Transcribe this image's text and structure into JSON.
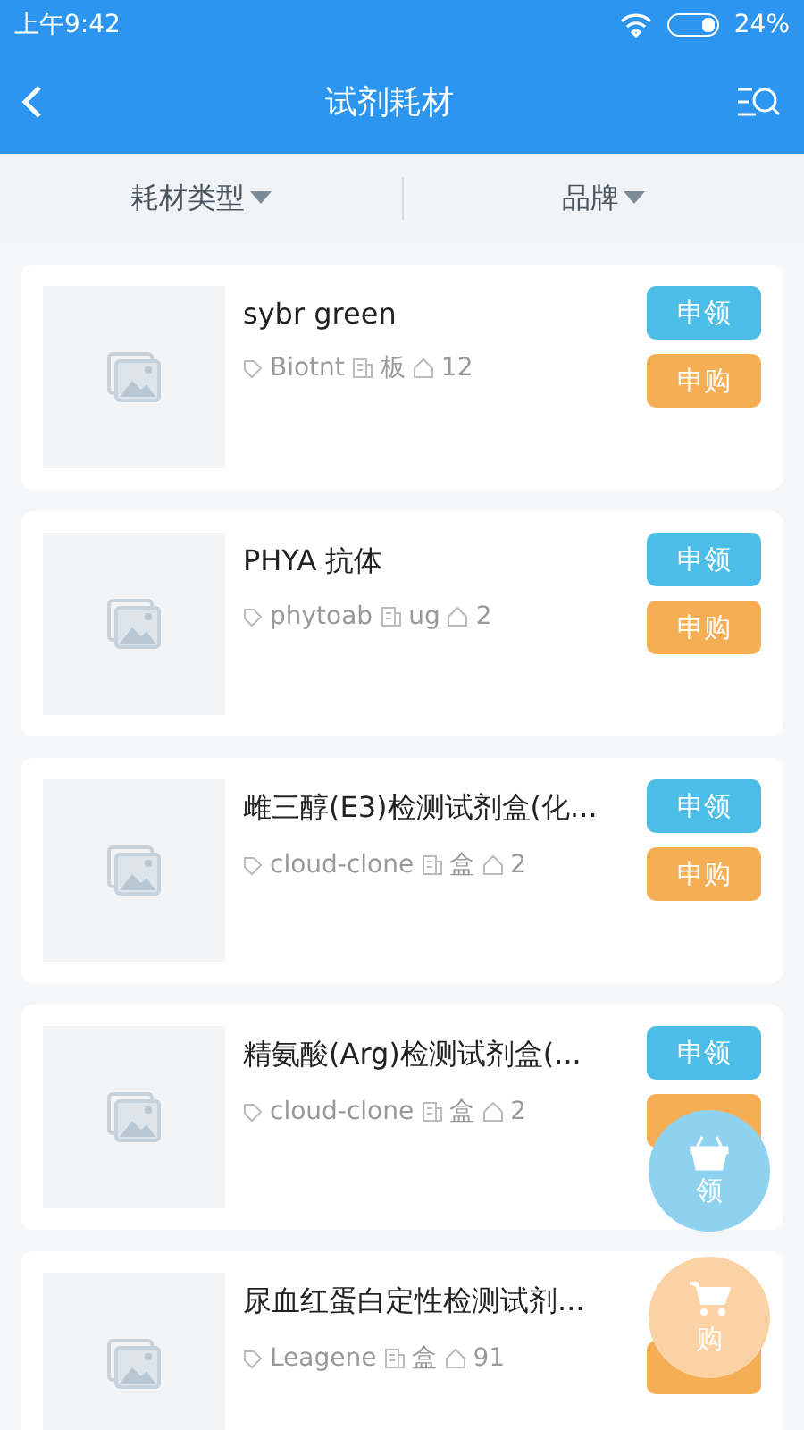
{
  "status_bar": {
    "time": "上午9:42",
    "battery": "24%"
  },
  "header": {
    "title": "试剂耗材"
  },
  "filters": [
    {
      "label": "耗材类型"
    },
    {
      "label": "品牌"
    }
  ],
  "items": [
    {
      "name": "sybr green",
      "brand": "Biotnt",
      "unit": "板",
      "stock": "12",
      "buttons": [
        {
          "kind": "request",
          "label": "申领"
        },
        {
          "kind": "purchase",
          "label": "申购"
        }
      ]
    },
    {
      "name": "PHYA 抗体",
      "brand": "phytoab",
      "unit": "ug",
      "stock": "2",
      "buttons": [
        {
          "kind": "request",
          "label": "申领"
        },
        {
          "kind": "purchase",
          "label": "申购"
        }
      ]
    },
    {
      "name": "雌三醇(E3)检测试剂盒(化...",
      "brand": "cloud-clone",
      "unit": "盒",
      "stock": "2",
      "buttons": [
        {
          "kind": "request",
          "label": "申领"
        },
        {
          "kind": "purchase",
          "label": "申购"
        }
      ]
    },
    {
      "name": "精氨酸(Arg)检测试剂盒(...",
      "brand": "cloud-clone",
      "unit": "盒",
      "stock": "2",
      "buttons": [
        {
          "kind": "request",
          "label": "申领"
        },
        {
          "kind": "purchase"
        }
      ]
    },
    {
      "name": "尿血红蛋白定性检测试剂...",
      "brand": "Leagene",
      "unit": "盒",
      "stock": "91",
      "buttons": [
        {
          "kind": "purchase"
        }
      ]
    }
  ],
  "floating_buttons": [
    {
      "kind": "basket",
      "label": "领"
    },
    {
      "kind": "cart",
      "label": "购"
    }
  ]
}
